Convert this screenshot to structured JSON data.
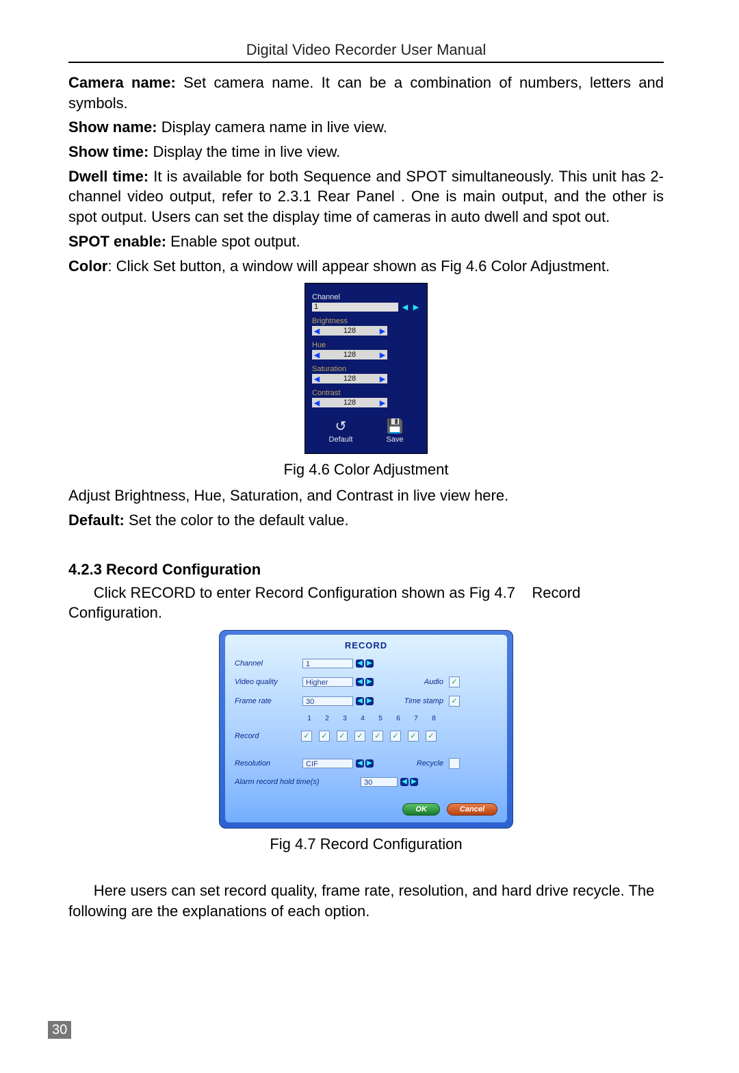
{
  "page": {
    "header_title": "Digital Video Recorder User Manual",
    "number": "30"
  },
  "defs": {
    "camera_name": {
      "label": "Camera name:",
      "text": " Set camera name. It can be a combination of numbers, letters and symbols."
    },
    "show_name": {
      "label": "Show name:",
      "text": " Display camera name in live view."
    },
    "show_time": {
      "label": "Show time:",
      "text": " Display the time in live view."
    },
    "dwell_time": {
      "label": "Dwell time:",
      "text": " It is available for both Sequence and SPOT simultaneously. This unit has 2-channel video output, refer to 2.3.1 Rear Panel . One is main output, and the other is spot output. Users can set the display time of cameras in auto dwell and spot out."
    },
    "spot_enable": {
      "label": "SPOT enable:",
      "text": " Enable spot output."
    },
    "color": {
      "label": "Color",
      "text": ": Click Set button, a window will appear shown as Fig 4.6    Color Adjustment."
    },
    "default": {
      "label": "Default:",
      "text": " Set the color to the default value."
    }
  },
  "fig46": {
    "caption": "Fig 4.6    Color Adjustment",
    "channel_label": "Channel",
    "channel_value": "1",
    "rows": {
      "brightness": {
        "label": "Brightness",
        "value": "128"
      },
      "hue": {
        "label": "Hue",
        "value": "128"
      },
      "saturation": {
        "label": "Saturation",
        "value": "128"
      },
      "contrast": {
        "label": "Contrast",
        "value": "128"
      }
    },
    "buttons": {
      "default": "Default",
      "save": "Save"
    }
  },
  "after46_line": "Adjust Brightness, Hue, Saturation, and Contrast in live view here.",
  "section_423": {
    "heading": "4.2.3  Record Configuration",
    "intro": "      Click RECORD to enter Record Configuration shown as Fig 4.7    Record Configuration."
  },
  "fig47": {
    "title": "RECORD",
    "caption": "Fig 4.7    Record Configuration",
    "channel": {
      "label": "Channel",
      "value": "1"
    },
    "video_quality": {
      "label": "Video quality",
      "value": "Higher"
    },
    "audio": {
      "label": "Audio",
      "checked": true
    },
    "frame_rate": {
      "label": "Frame rate",
      "value": "30"
    },
    "time_stamp": {
      "label": "Time stamp",
      "checked": true
    },
    "record": {
      "label": "Record",
      "cols": [
        "1",
        "2",
        "3",
        "4",
        "5",
        "6",
        "7",
        "8"
      ],
      "checked": [
        true,
        true,
        true,
        true,
        true,
        true,
        true,
        true
      ]
    },
    "resolution": {
      "label": "Resolution",
      "value": "CIF"
    },
    "recycle": {
      "label": "Recycle",
      "checked": false
    },
    "alarm_hold": {
      "label": "Alarm record hold time(s)",
      "value": "30"
    },
    "buttons": {
      "ok": "OK",
      "cancel": "Cancel"
    }
  },
  "closing_para": "      Here users can set record quality, frame rate, resolution, and hard drive recycle. The following are the explanations of each option."
}
